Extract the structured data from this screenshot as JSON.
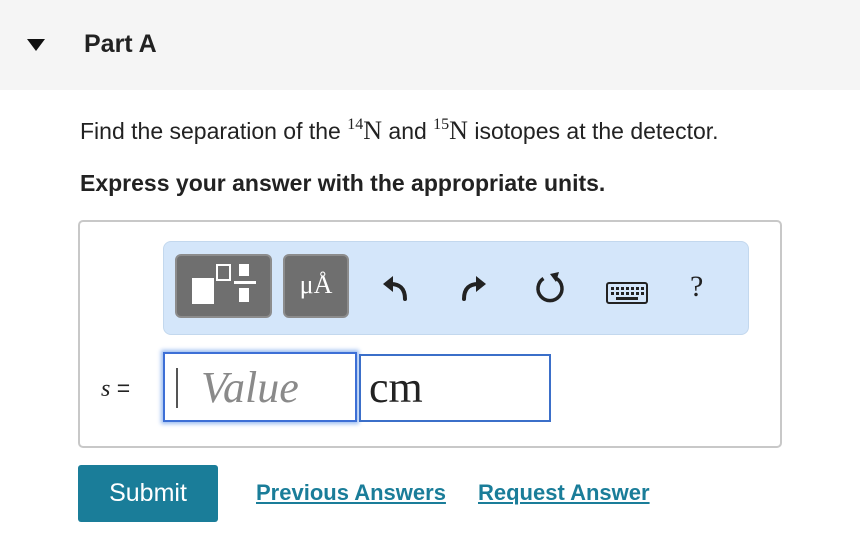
{
  "part": {
    "title": "Part A"
  },
  "question": {
    "prefix": "Find the separation of the",
    "iso1_mass": "14",
    "iso1_symbol": "N",
    "connector": "and",
    "iso2_mass": "15",
    "iso2_symbol": "N",
    "suffix": "isotopes at the detector."
  },
  "instruction": "Express your answer with the appropriate units.",
  "toolbar": {
    "units_label": "μÅ",
    "help_label": "?",
    "icons": [
      "templates-icon",
      "units-icon",
      "undo-icon",
      "redo-icon",
      "reset-icon",
      "keyboard-icon",
      "help-icon"
    ]
  },
  "answer": {
    "variable": "s",
    "equals": "=",
    "value_placeholder": "Value",
    "units_value": "cm"
  },
  "actions": {
    "submit": "Submit",
    "previous_answers": "Previous Answers",
    "request_answer": "Request Answer"
  },
  "colors": {
    "header_bg": "#f5f5f5",
    "toolbar_bg": "#d4e6fa",
    "button_gray": "#6f6f6f",
    "accent": "#1a7d99",
    "focus_border": "#3d6fd6"
  }
}
